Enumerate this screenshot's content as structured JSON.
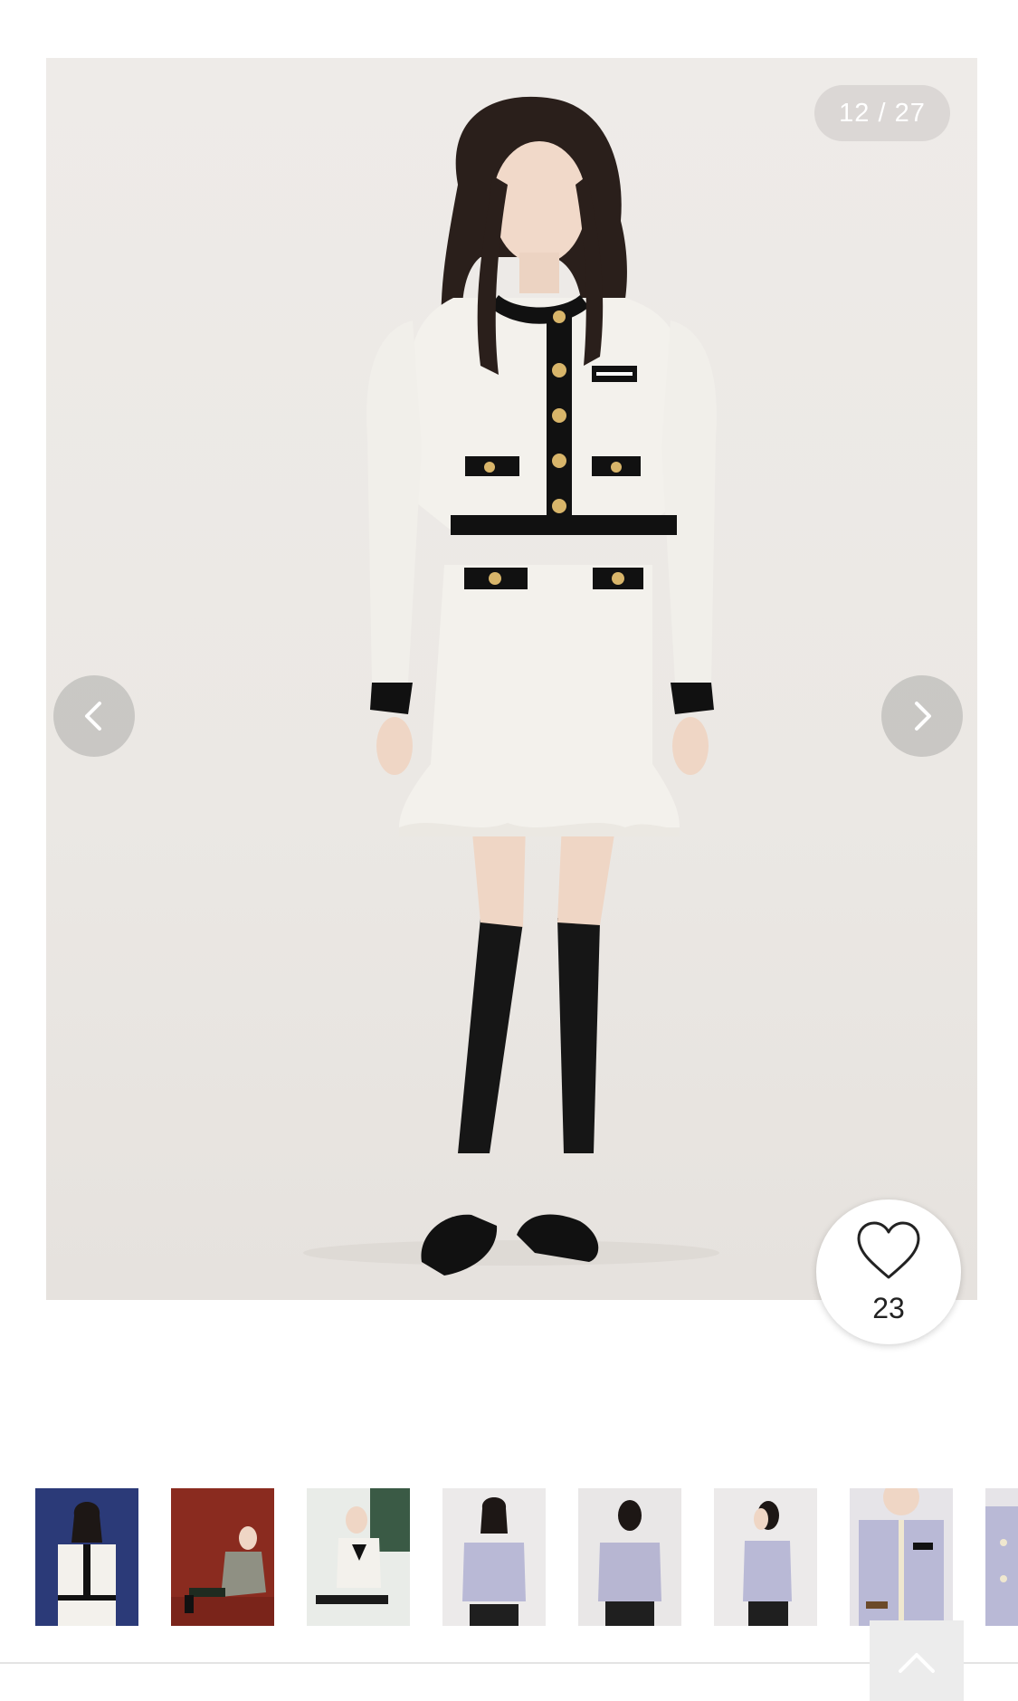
{
  "gallery": {
    "counter": "12 / 27",
    "prev_icon": "chevron-left-icon",
    "next_icon": "chevron-right-icon"
  },
  "like": {
    "icon": "heart-icon",
    "count": "23"
  },
  "thumbnails": [
    {
      "bg": "#2b3a78"
    },
    {
      "bg": "#8a2b1f"
    },
    {
      "bg": "#e9ece8"
    },
    {
      "bg": "#eceaea"
    },
    {
      "bg": "#e9e7e7"
    },
    {
      "bg": "#eceaea"
    },
    {
      "bg": "#e6e4e8"
    },
    {
      "bg": "#e6e4e8"
    }
  ],
  "back_to_top": {
    "icon": "chevron-up-icon"
  },
  "colors": {
    "knit_white": "#f3f1ec",
    "trim_black": "#111111",
    "button_gold": "#d8b56a",
    "lavender": "#b9b9d6"
  }
}
